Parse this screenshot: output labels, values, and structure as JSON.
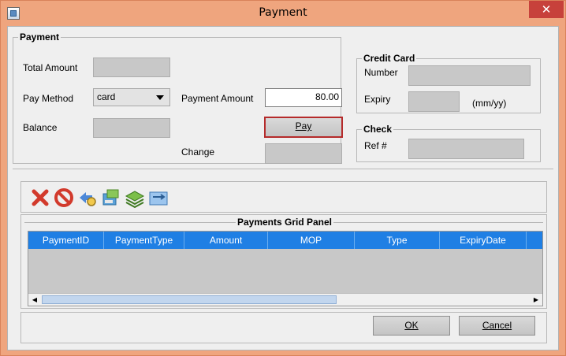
{
  "window": {
    "title": "Payment"
  },
  "payment": {
    "legend": "Payment",
    "total_amount_label": "Total Amount",
    "pay_method_label": "Pay Method",
    "pay_method_value": "card",
    "payment_amount_label": "Payment Amount",
    "payment_amount_value": "80.00",
    "balance_label": "Balance",
    "pay_button_label": "Pay",
    "change_label": "Change"
  },
  "credit_card": {
    "legend": "Credit Card",
    "number_label": "Number",
    "expiry_label": "Expiry",
    "expiry_hint": "(mm/yy)"
  },
  "check": {
    "legend": "Check",
    "ref_label": "Ref #"
  },
  "toolbar": {
    "icons": [
      "delete-icon",
      "cancel-icon",
      "search-icon",
      "print-icon",
      "stack-icon",
      "transfer-icon"
    ]
  },
  "grid": {
    "title": "Payments Grid Panel",
    "columns": [
      "PaymentID",
      "PaymentType",
      "Amount",
      "MOP",
      "Type",
      "ExpiryDate"
    ],
    "rows": []
  },
  "footer": {
    "ok_label": "OK",
    "cancel_label": "Cancel"
  },
  "colors": {
    "title_bar": "#efa57e",
    "close_button": "#c7413b",
    "grid_header": "#1f7fe4",
    "focus_border": "#b52b2b"
  }
}
